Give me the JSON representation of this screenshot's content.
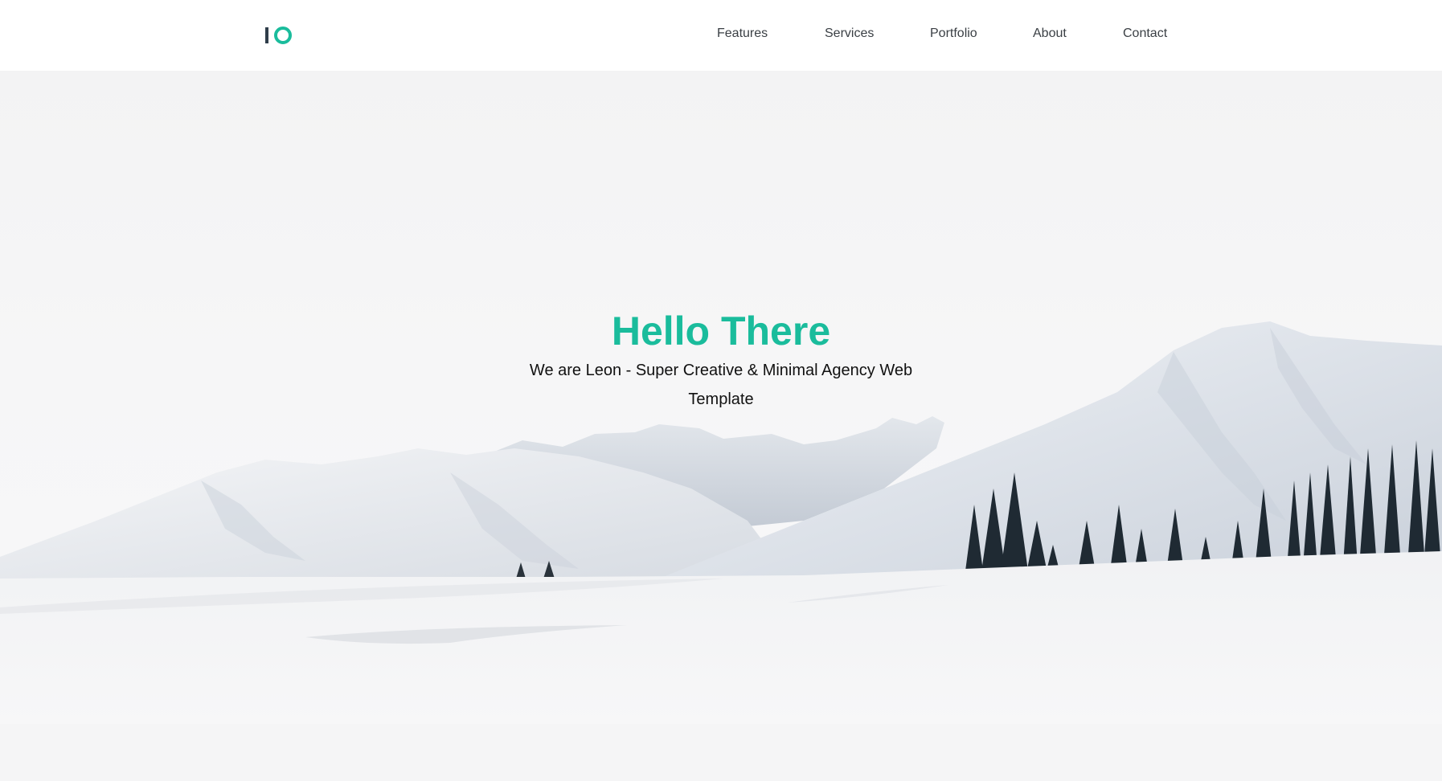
{
  "navbar": {
    "logo_icon": "logo-icon",
    "links": [
      "Features",
      "Services",
      "Portfolio",
      "About",
      "Contact"
    ]
  },
  "hero": {
    "title": "Hello There",
    "subtitle": "We are Leon - Super Creative & Minimal Agency Web Template",
    "background_image": "snowy-mountains-landscape"
  },
  "colors": {
    "accent": "#1abc9c",
    "nav_text": "#3a3f44",
    "navbar_bg": "#ffffff",
    "page_bg": "#f5f5f6"
  }
}
